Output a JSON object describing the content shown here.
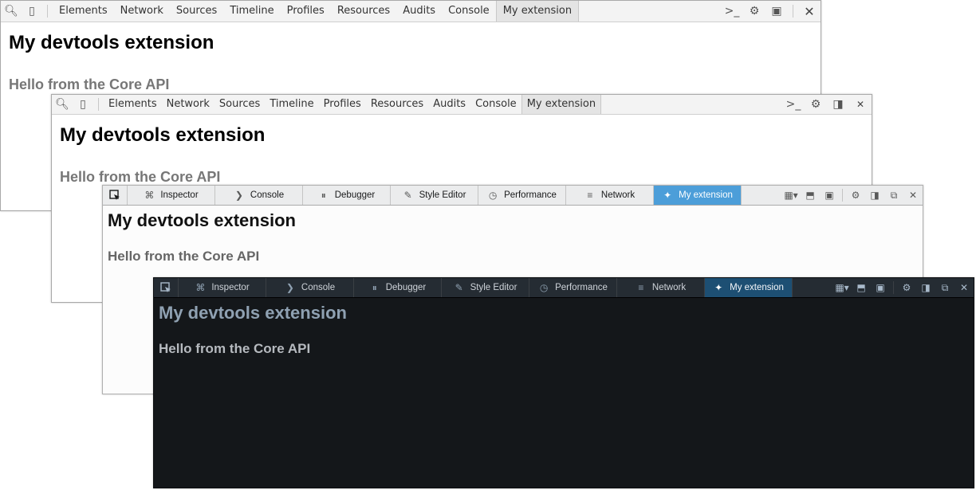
{
  "windows": {
    "chrome1": {
      "tabs": [
        "Elements",
        "Network",
        "Sources",
        "Timeline",
        "Profiles",
        "Resources",
        "Audits",
        "Console",
        "My extension"
      ],
      "selected_tab": "My extension",
      "heading": "My devtools extension",
      "subheading": "Hello from the Core API"
    },
    "chrome2": {
      "tabs": [
        "Elements",
        "Network",
        "Sources",
        "Timeline",
        "Profiles",
        "Resources",
        "Audits",
        "Console",
        "My extension"
      ],
      "selected_tab": "My extension",
      "heading": "My devtools extension",
      "subheading": "Hello from the Core API"
    },
    "firefox_light": {
      "theme": "light",
      "tabs": [
        {
          "label": "Inspector",
          "icon": "inspector-icon"
        },
        {
          "label": "Console",
          "icon": "console-icon"
        },
        {
          "label": "Debugger",
          "icon": "debugger-icon"
        },
        {
          "label": "Style Editor",
          "icon": "style-editor-icon"
        },
        {
          "label": "Performance",
          "icon": "performance-icon"
        },
        {
          "label": "Network",
          "icon": "network-icon"
        },
        {
          "label": "My extension",
          "icon": "extension-icon"
        }
      ],
      "selected_tab": "My extension",
      "heading": "My devtools extension",
      "subheading": "Hello from the Core API"
    },
    "firefox_dark": {
      "theme": "dark",
      "tabs": [
        {
          "label": "Inspector",
          "icon": "inspector-icon"
        },
        {
          "label": "Console",
          "icon": "console-icon"
        },
        {
          "label": "Debugger",
          "icon": "debugger-icon"
        },
        {
          "label": "Style Editor",
          "icon": "style-editor-icon"
        },
        {
          "label": "Performance",
          "icon": "performance-icon"
        },
        {
          "label": "Network",
          "icon": "network-icon"
        },
        {
          "label": "My extension",
          "icon": "extension-icon"
        }
      ],
      "selected_tab": "My extension",
      "heading": "My devtools extension",
      "subheading": "Hello from the Core API"
    }
  },
  "colors": {
    "ff_light_selected": "#4c9ed9",
    "ff_dark_selected": "#1d4f73",
    "ff_dark_background": "#14171a",
    "ff_dark_heading": "#8fa1b2"
  }
}
